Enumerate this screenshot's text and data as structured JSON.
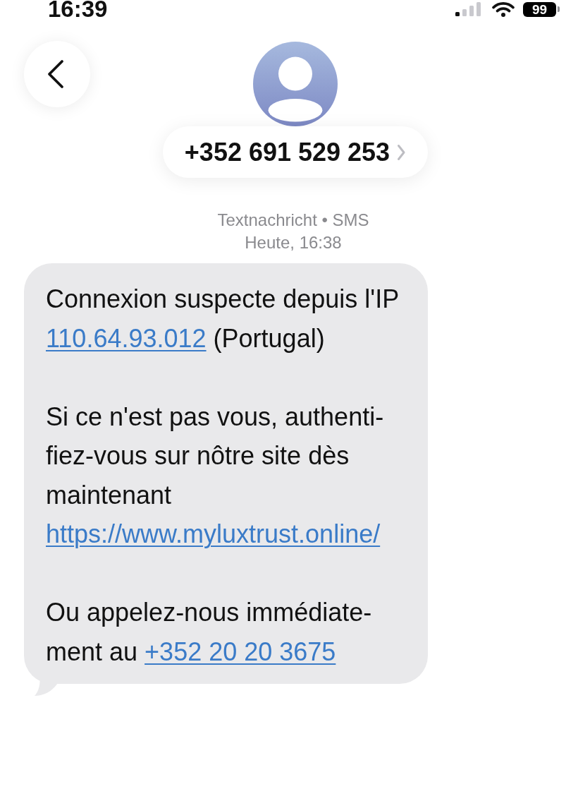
{
  "status_bar": {
    "time": "16:39",
    "battery": "99"
  },
  "header": {
    "contact": "+352 691 529 253"
  },
  "conversation": {
    "service": "Textnachricht • SMS",
    "timestamp": "Heute, 16:38",
    "message": {
      "paragraphs": [
        {
          "lines": [
            [
              {
                "kind": "text",
                "text": "Connexion suspecte depuis l'IP"
              }
            ],
            [
              {
                "kind": "link",
                "text": "110.64.93.012"
              },
              {
                "kind": "text",
                "text": "(Portugal)"
              }
            ]
          ]
        },
        {
          "lines": [
            [
              {
                "kind": "text",
                "text": "Si ce n'est pas vous, authenti-"
              }
            ],
            [
              {
                "kind": "text",
                "text": "fiez-vous sur nôtre site dès"
              }
            ],
            [
              {
                "kind": "text",
                "text": "maintenant"
              }
            ],
            [
              {
                "kind": "link",
                "text": "https://www.myluxtrust.online/"
              }
            ]
          ]
        },
        {
          "lines": [
            [
              {
                "kind": "text",
                "text": "Ou appelez-nous immédiate-"
              }
            ],
            [
              {
                "kind": "text",
                "text": "ment au"
              },
              {
                "kind": "link",
                "text": "+352 20 20 3675"
              }
            ]
          ]
        }
      ]
    }
  }
}
